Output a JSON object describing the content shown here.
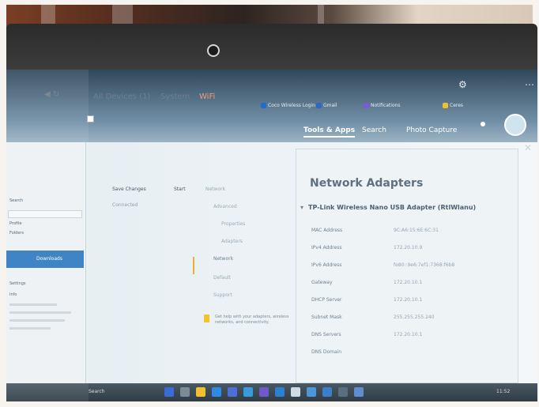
{
  "browser": {
    "bookmarks": [
      "Coco Wireless Login",
      "Gmail",
      "Notifications",
      "Ceres"
    ],
    "nav_tabs": [
      "Tools & Apps",
      "Search",
      "Photo Capture"
    ],
    "active_nav": "Tools & Apps"
  },
  "sidebar": {
    "items": [
      "Search",
      "Profile",
      "Folders",
      "Settings",
      "Info"
    ],
    "selected_item": "Downloads"
  },
  "app": {
    "tabs": [
      "All Devices (1)",
      "System",
      "WiFi"
    ],
    "active_tab": "WiFi",
    "device_header": "Save Changes",
    "device_header_right": "Start",
    "device_name": "Connected",
    "settings": [
      "Network",
      "Advanced",
      "Properties",
      "Adapters",
      "Network",
      "Default",
      "Support"
    ],
    "selected_setting": "Network",
    "info_text": "Get help with your adapters, wireless networks, and connectivity."
  },
  "panel": {
    "title": "Network Adapters",
    "adapter_name": "TP-Link Wireless Nano USB Adapter (RtlWlanu)",
    "properties": [
      {
        "label": "MAC Address",
        "value": "9C:A6:15:6E:6C:31"
      },
      {
        "label": "IPv4 Address",
        "value": "172.20.10.9"
      },
      {
        "label": "IPv6 Address",
        "value": "fe80::9e6:7ef1:7368:f6b8"
      },
      {
        "label": "Gateway",
        "value": "172.20.10.1"
      },
      {
        "label": "DHCP Server",
        "value": "172.20.10.1"
      },
      {
        "label": "Subnet Mask",
        "value": "255.255.255.240"
      },
      {
        "label": "DNS Servers",
        "value": "172.20.10.1"
      },
      {
        "label": "DNS Domain",
        "value": ""
      }
    ]
  },
  "taskbar": {
    "search_label": "Search",
    "time_label": "11:52"
  }
}
